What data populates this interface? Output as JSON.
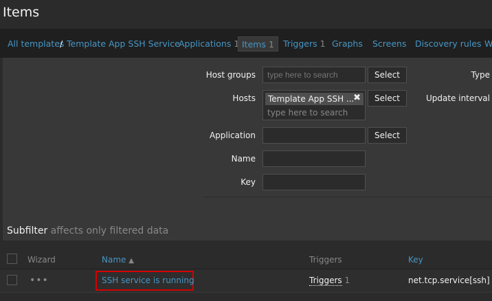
{
  "header": {
    "title": "Items"
  },
  "nav": {
    "all_templates": "All templates",
    "separator": "/",
    "template": "Template App SSH Service",
    "applications": "Applications",
    "applications_count": "1",
    "items": "Items",
    "items_count": "1",
    "triggers": "Triggers",
    "triggers_count": "1",
    "graphs": "Graphs",
    "screens": "Screens",
    "discovery": "Discovery rules",
    "web": "W"
  },
  "filter": {
    "host_groups_label": "Host groups",
    "host_groups_placeholder": "type here to search",
    "select_label": "Select",
    "hosts_label": "Hosts",
    "hosts_chip": "Template App SSH ...",
    "hosts_placeholder": "type here to search",
    "application_label": "Application",
    "name_label": "Name",
    "key_label": "Key",
    "type_label": "Type",
    "update_interval_label": "Update interval"
  },
  "subfilter": {
    "title": "Subfilter",
    "note": "affects only filtered data"
  },
  "table": {
    "columns": {
      "wizard": "Wizard",
      "name": "Name",
      "name_sort": "▲",
      "triggers": "Triggers",
      "key": "Key"
    },
    "rows": [
      {
        "wizard": "•••",
        "name": "SSH service is running",
        "triggers": "Triggers",
        "triggers_count": "1",
        "key": "net.tcp.service[ssh]"
      }
    ]
  }
}
